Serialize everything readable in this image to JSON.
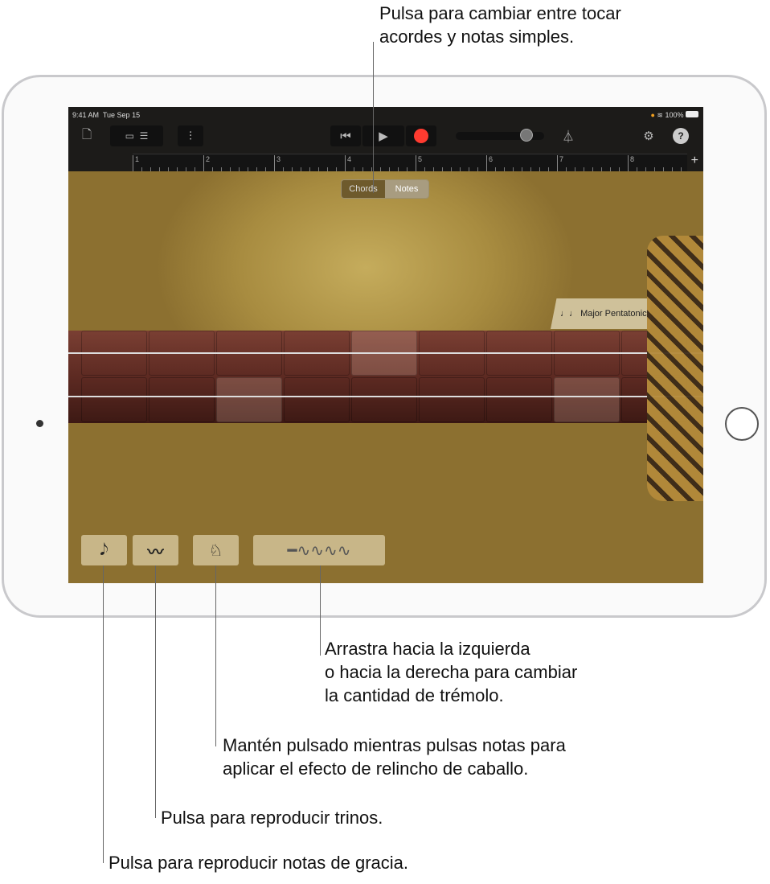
{
  "status": {
    "time": "9:41 AM",
    "date": "Tue Sep 15",
    "battery": "100%"
  },
  "toolbar": {
    "icons": [
      "document-icon",
      "view-toggle-icon",
      "tracks-icon",
      "mixer-icon",
      "rewind-icon",
      "play-icon",
      "record-icon",
      "volume-slider",
      "metronome-icon",
      "settings-icon",
      "help-icon"
    ],
    "record_color": "#ff3b30",
    "volume": 0.8
  },
  "ruler": {
    "bars": [
      "1",
      "2",
      "3",
      "4",
      "5",
      "6",
      "7",
      "8"
    ],
    "add": "+"
  },
  "segmented": {
    "chords": "Chords",
    "notes": "Notes",
    "selected": "Notes"
  },
  "scale": {
    "icon": "♩♩",
    "label": "Major Pentatonic"
  },
  "controls": {
    "grace": "𝅘𝅥𝅮",
    "trill": "〰",
    "horse": "horse-icon",
    "tremolo": "tremolo-slider"
  },
  "callouts": {
    "top": [
      "Pulsa para cambiar entre tocar",
      "acordes y notas simples."
    ],
    "tremolo": [
      "Arrastra hacia la izquierda",
      "o hacia la derecha para cambiar",
      "la cantidad de trémolo."
    ],
    "horse": [
      "Mantén pulsado mientras pulsas notas para",
      "aplicar el efecto de relincho de caballo."
    ],
    "trill": "Pulsa para reproducir trinos.",
    "grace": "Pulsa para reproducir notas de gracia."
  }
}
